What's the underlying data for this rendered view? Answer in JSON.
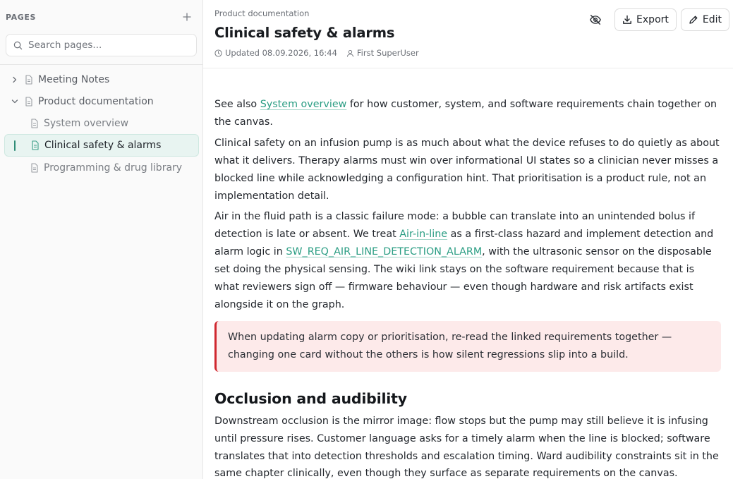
{
  "sidebar": {
    "title": "PAGES",
    "search_placeholder": "Search pages...",
    "items": [
      {
        "label": "Meeting Notes",
        "level": 0,
        "expanded": false
      },
      {
        "label": "Product documentation",
        "level": 0,
        "expanded": true
      },
      {
        "label": "System overview",
        "level": 1
      },
      {
        "label": "Clinical safety & alarms",
        "level": 1,
        "active": true
      },
      {
        "label": "Programming & drug library",
        "level": 1
      }
    ]
  },
  "header": {
    "breadcrumb": "Product documentation",
    "title": "Clinical safety & alarms",
    "updated": "Updated 08.09.2026, 16:44",
    "author": "First SuperUser",
    "export_label": "Export",
    "edit_label": "Edit"
  },
  "content": {
    "p1_a": "See also ",
    "p1_link": "System overview",
    "p1_b": " for how customer, system, and software requirements chain together on the canvas.",
    "p2": "Clinical safety on an infusion pump is as much about what the device refuses to do quietly as about what it delivers. Therapy alarms must win over informational UI states so a clinician never misses a blocked line while acknowledging a configuration hint. That prioritisation is a product rule, not an implementation detail.",
    "p3_a": "Air in the fluid path is a classic failure mode: a bubble can translate into an unintended bolus if detection is late or absent. We treat ",
    "p3_link1": "Air-in-line",
    "p3_b": " as a first-class hazard and implement detection and alarm logic in ",
    "p3_link2": "SW_REQ_AIR_LINE_DETECTION_ALARM",
    "p3_c": ", with the ultrasonic sensor on the disposable set doing the physical sensing. The wiki link stays on the software requirement because that is what reviewers sign off — firmware behaviour — even though hardware and risk artifacts exist alongside it on the graph.",
    "callout": "When updating alarm copy or prioritisation, re-read the linked requirements together — changing one card without the others is how silent regressions slip into a build.",
    "h2": "Occlusion and audibility",
    "p4": "Downstream occlusion is the mirror image: flow stops but the pump may still believe it is infusing until pressure rises. Customer language asks for a timely alarm when the line is blocked; software translates that into detection thresholds and escalation timing. Ward audibility constraints sit in the same chapter clinically, even though they surface as separate requirements on the canvas."
  },
  "colors": {
    "accent": "#2a9d83",
    "callout_bg": "#fdeaea",
    "callout_border": "#d0272f",
    "active_bg": "#e8f4f1"
  }
}
